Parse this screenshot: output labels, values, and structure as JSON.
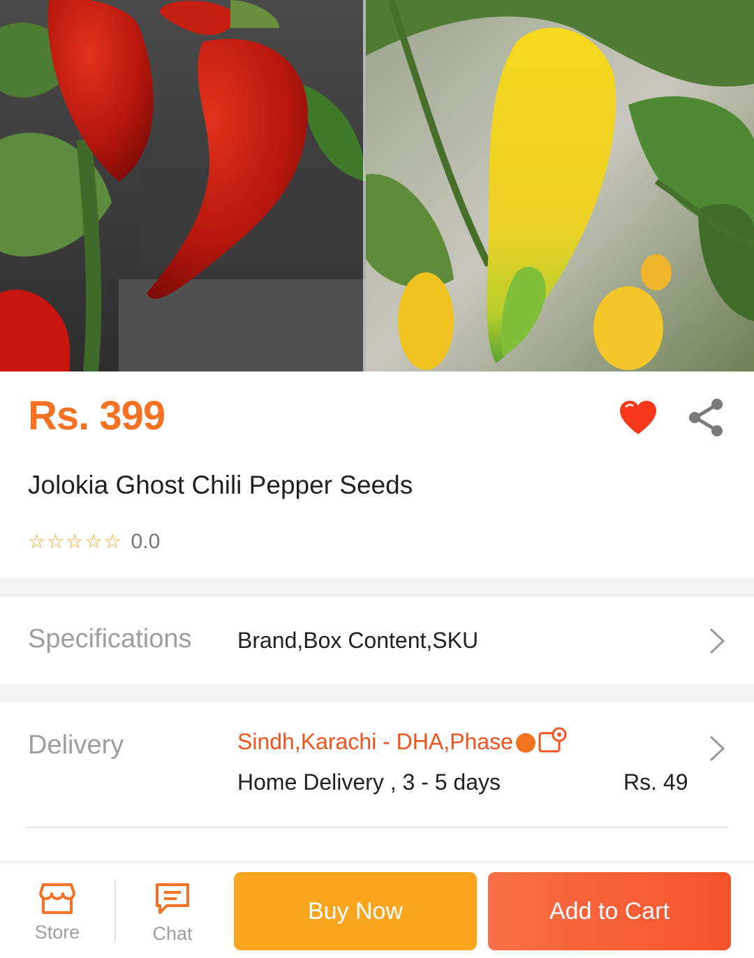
{
  "product": {
    "price": "Rs. 399",
    "title": "Jolokia Ghost Chili Pepper Seeds",
    "rating": "0.0",
    "stars": [
      "☆",
      "☆",
      "☆",
      "☆",
      "☆"
    ],
    "wishlisted": true,
    "icons": {
      "wishlist": "heart-icon",
      "share": "share-icon"
    }
  },
  "specifications": {
    "label": "Specifications",
    "value": "Brand,Box Content,SKU"
  },
  "delivery": {
    "label": "Delivery",
    "location": "Sindh,Karachi - DHA,Phase",
    "method": "Home Delivery , 3 - 5 days",
    "fee": "Rs. 49"
  },
  "bottom_bar": {
    "store_label": "Store",
    "chat_label": "Chat",
    "buy_now_label": "Buy Now",
    "add_to_cart_label": "Add to Cart"
  },
  "colors": {
    "accent": "#f57224",
    "buy_now": "#f9a51e",
    "add_to_cart": "#f5532b",
    "heart": "#f5371b"
  }
}
